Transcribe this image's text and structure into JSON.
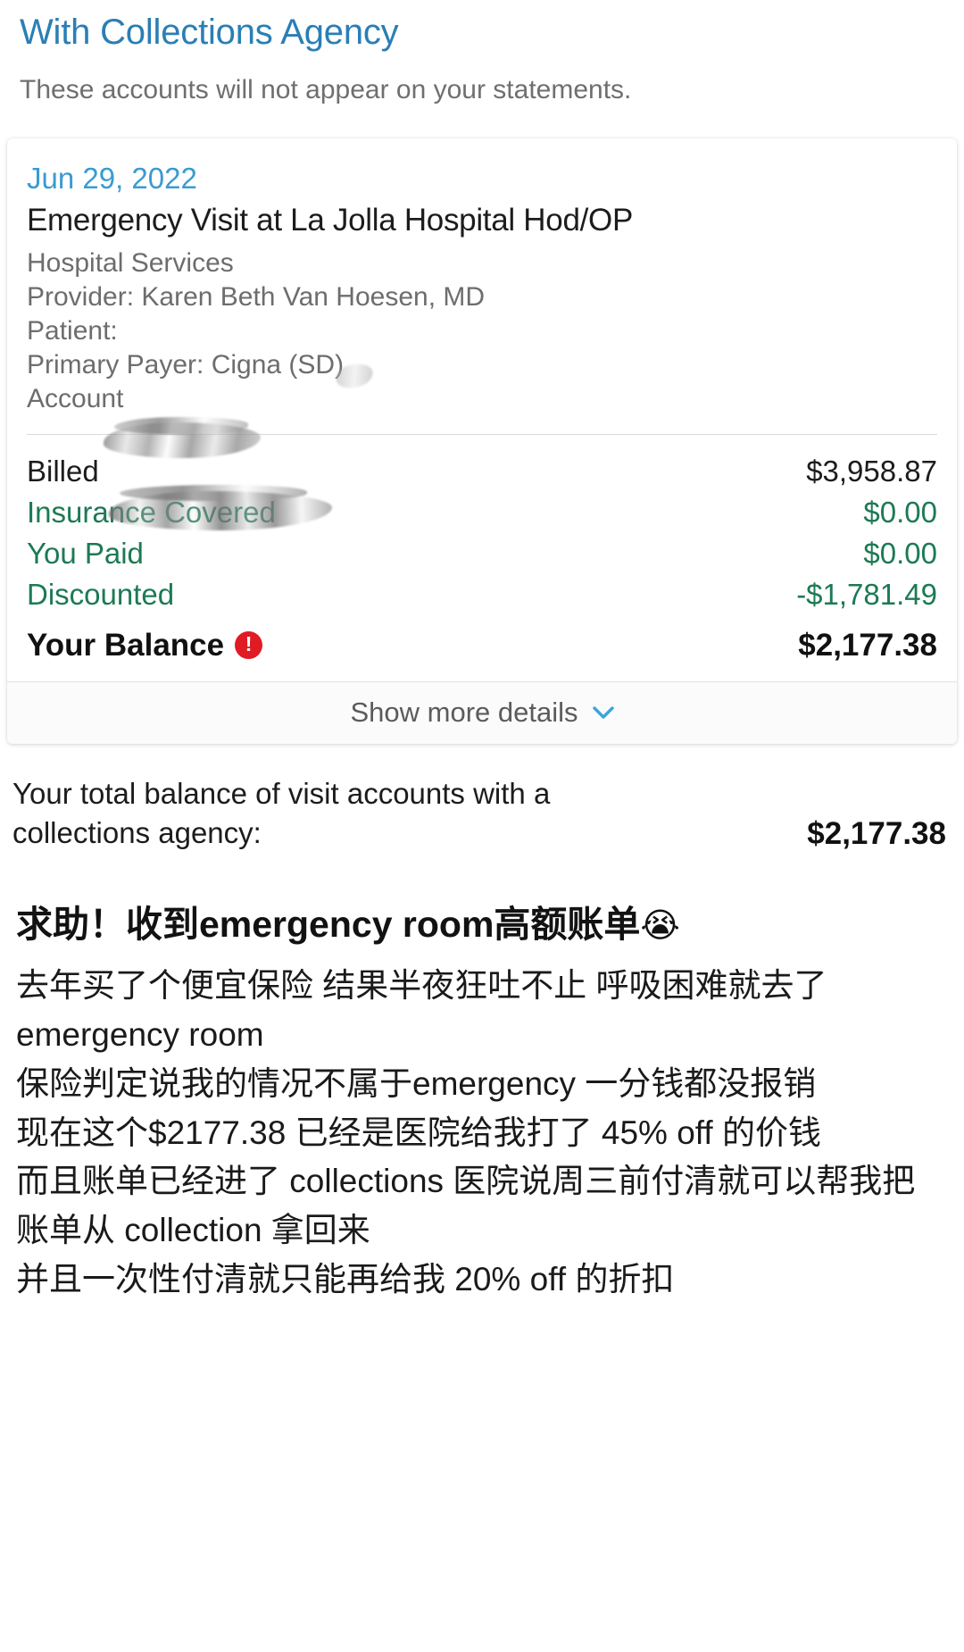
{
  "header": {
    "title": "With Collections Agency",
    "subtitle": "These accounts will not appear on your statements."
  },
  "account_card": {
    "date": "Jun 29, 2022",
    "visit_title": "Emergency Visit at La Jolla Hospital Hod/OP",
    "service_type": "Hospital Services",
    "provider_line": "Provider: Karen Beth Van Hoesen, MD",
    "patient_line": "Patient:",
    "payer_line": "Primary Payer: Cigna (SD)",
    "account_line": "Account",
    "amounts": [
      {
        "label": "Billed",
        "value": "$3,958.87",
        "style": "neutral"
      },
      {
        "label": "Insurance Covered",
        "value": "$0.00",
        "style": "green"
      },
      {
        "label": "You Paid",
        "value": "$0.00",
        "style": "green"
      },
      {
        "label": "Discounted",
        "value": "-$1,781.49",
        "style": "green"
      }
    ],
    "balance": {
      "label": "Your Balance",
      "value": "$2,177.38"
    },
    "show_more_label": "Show more details",
    "alert_icon": "alert-exclamation-icon",
    "chevron_icon": "chevron-down-icon",
    "colors": {
      "date_blue": "#3a9bd1",
      "green": "#1d7a54",
      "alert_red": "#e01b24",
      "chevron_blue": "#3aa6d8"
    }
  },
  "total_summary": {
    "text": "Your total balance of visit accounts with a collections agency:",
    "amount": "$2,177.38"
  },
  "post": {
    "title": "求助！收到emergency room高额账单",
    "title_emoji": "😭",
    "paragraphs": [
      "去年买了个便宜保险 结果半夜狂吐不止 呼吸困难就去了 emergency room",
      "保险判定说我的情况不属于emergency 一分钱都没报销",
      "现在这个$2177.38 已经是医院给我打了 45% off 的价钱",
      "而且账单已经进了 collections 医院说周三前付清就可以帮我把账单从 collection 拿回来",
      "并且一次性付清就只能再给我 20% off 的折扣"
    ]
  }
}
